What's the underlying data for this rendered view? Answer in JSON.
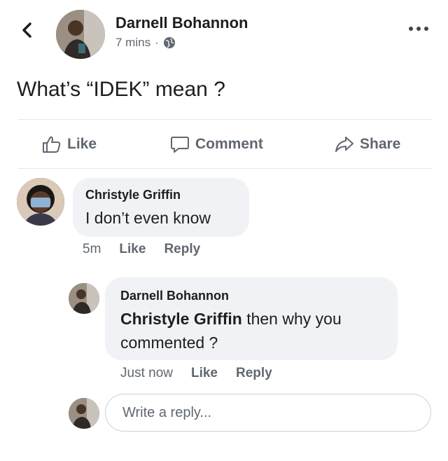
{
  "post": {
    "author": "Darnell Bohannon",
    "time": "7 mins",
    "separator": "·",
    "privacy_icon": "globe-icon",
    "text": "What’s “IDEK” mean ?",
    "actions": {
      "like": "Like",
      "comment": "Comment",
      "share": "Share"
    }
  },
  "comments": [
    {
      "author": "Christyle Griffin",
      "text": "I don’t even know",
      "time": "5m",
      "like": "Like",
      "reply": "Reply"
    },
    {
      "author": "Darnell Bohannon",
      "mention": "Christyle Griffin",
      "text": " then why you commented ?",
      "time": "Just now",
      "like": "Like",
      "reply": "Reply"
    }
  ],
  "reply_box": {
    "placeholder": "Write a reply..."
  },
  "colors": {
    "text": "#1c1e21",
    "secondary": "#606770",
    "bubble": "#f0f2f5",
    "divider": "#e4e6eb"
  }
}
